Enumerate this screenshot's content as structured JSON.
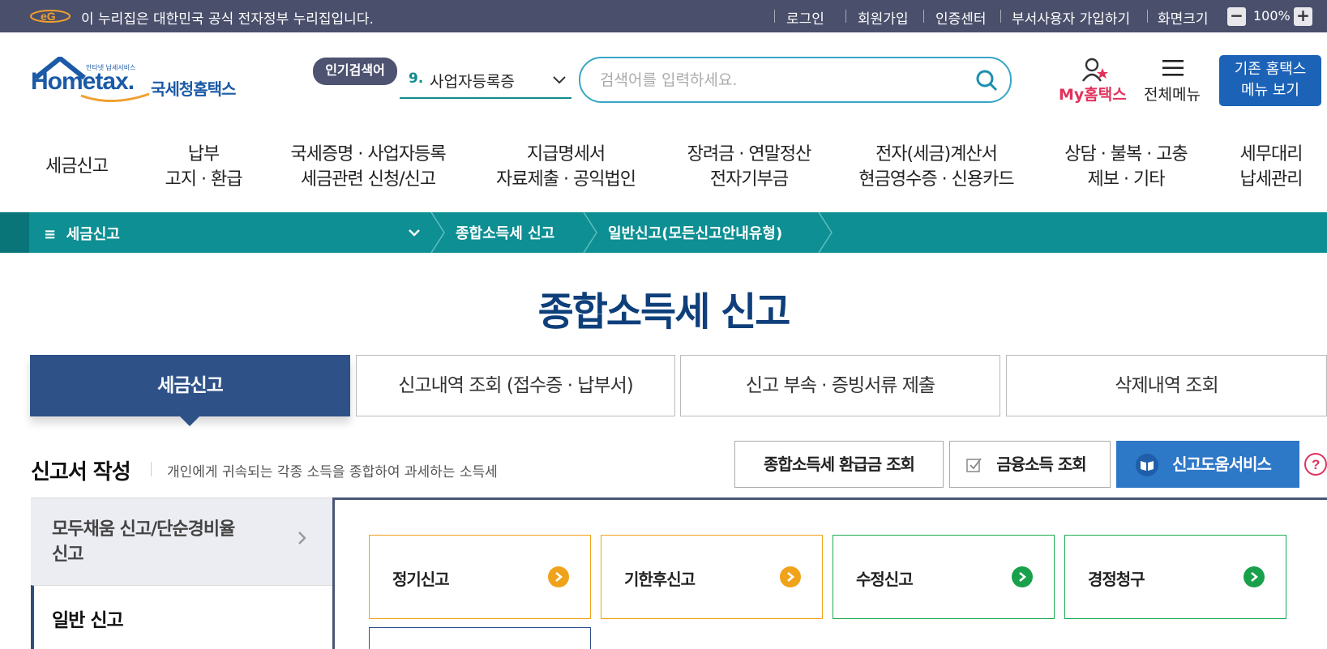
{
  "gov_bar": {
    "notice": "이 누리집은 대한민국 공식 전자정부 누리집입니다.",
    "links": [
      "로그인",
      "회원가입",
      "인증센터",
      "부서사용자 가입하기",
      "화면크기"
    ],
    "zoom_minus": "−",
    "zoom_value": "100%",
    "zoom_plus": "+"
  },
  "header": {
    "logo_main": "Hometax.",
    "logo_kr": "국세청홈택스",
    "logo_small": "안타넷 납세서비스",
    "popular_badge": "인기검색어",
    "popular_rank": "9.",
    "popular_keyword": "사업자등록증",
    "search_placeholder": "검색어를 입력하세요.",
    "my_label": "My홈택스",
    "menu_label": "전체메뉴",
    "legacy_line1": "기존 홈택스",
    "legacy_line2": "메뉴 보기"
  },
  "gnb": [
    {
      "line1": "세금신고",
      "line2": ""
    },
    {
      "line1": "납부",
      "line2": "고지 · 환급"
    },
    {
      "line1": "국세증명 · 사업자등록",
      "line2": "세금관련 신청/신고"
    },
    {
      "line1": "지급명세서",
      "line2": "자료제출 · 공익법인"
    },
    {
      "line1": "장려금 · 연말정산",
      "line2": "전자기부금"
    },
    {
      "line1": "전자(세금)계산서",
      "line2": "현금영수증 · 신용카드"
    },
    {
      "line1": "상담 · 불복 · 고충",
      "line2": "제보 · 기타"
    },
    {
      "line1": "세무대리",
      "line2": "납세관리"
    }
  ],
  "breadcrumb": {
    "root": "세금신고",
    "level2": "종합소득세 신고",
    "level3": "일반신고(모든신고안내유형)"
  },
  "page_title": "종합소득세 신고",
  "tabs": [
    {
      "label": "세금신고",
      "active": true
    },
    {
      "label": "신고내역 조회 (접수증 · 납부서)",
      "active": false
    },
    {
      "label": "신고 부속 · 증빙서류 제출",
      "active": false
    },
    {
      "label": "삭제내역 조회",
      "active": false
    }
  ],
  "section": {
    "title": "신고서 작성",
    "desc": "개인에게 귀속되는 각종 소득을 종합하여 과세하는 소득세",
    "btn_refund": "종합소득세 환급금 조회",
    "btn_finance": "금융소득 조회",
    "btn_help": "신고도움서비스"
  },
  "left_menu": {
    "item1_line1": "모두채움 신고/단순경비율",
    "item1_line2": "신고",
    "item2": "일반 신고"
  },
  "cards": [
    {
      "label": "정기신고",
      "color": "#f0a21b"
    },
    {
      "label": "기한후신고",
      "color": "#f0a21b"
    },
    {
      "label": "수정신고",
      "color": "#18a04a"
    },
    {
      "label": "경정청구",
      "color": "#18a04a"
    }
  ],
  "colors": {
    "brand_navy": "#0e3f7a",
    "teal": "#0d8f93",
    "gov_bar": "#4a4f6b",
    "accent_pink": "#e0325c"
  }
}
